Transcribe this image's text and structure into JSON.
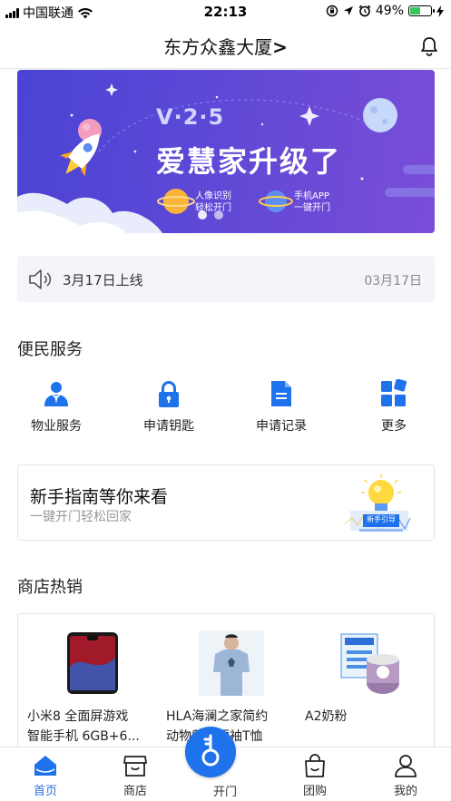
{
  "status_bar": {
    "carrier": "中国联通",
    "time": "22:13",
    "battery_percent": "49%",
    "battery_level": 0.49
  },
  "header": {
    "title": "东方众鑫大厦",
    "title_arrow": ">"
  },
  "banner": {
    "version": "V·2·5",
    "headline": "爱慧家升级了",
    "feature_1_line_1": "人像识别",
    "feature_1_line_2": "轻松开门",
    "feature_2_line_1": "手机APP",
    "feature_2_line_2": "一键开门",
    "page_count": 2,
    "active_page": 1
  },
  "notice": {
    "text": "3月17日上线",
    "date": "03月17日"
  },
  "services_section": {
    "title": "便民服务",
    "items": [
      {
        "label": "物业服务",
        "icon": "property-service-icon"
      },
      {
        "label": "申请钥匙",
        "icon": "lock-icon"
      },
      {
        "label": "申请记录",
        "icon": "document-icon"
      },
      {
        "label": "更多",
        "icon": "grid-more-icon"
      }
    ]
  },
  "guide": {
    "title": "新手指南等你来看",
    "subtitle": "一键开门轻松回家",
    "badge": "新手引导"
  },
  "shop_section": {
    "title": "商店热销",
    "products": [
      {
        "name_line_1": "小米8 全面屏游戏",
        "name_line_2": "智能手机 6GB+6..."
      },
      {
        "name_line_1": "HLA海澜之家简约",
        "name_line_2": "动物印花短袖T恤"
      },
      {
        "name_line_1": "A2奶粉",
        "name_line_2": ""
      }
    ]
  },
  "tabbar": {
    "tabs": [
      {
        "label": "首页",
        "icon": "home-icon",
        "active": true
      },
      {
        "label": "商店",
        "icon": "store-icon",
        "active": false
      },
      {
        "label": "开门",
        "icon": "key-icon",
        "active": false
      },
      {
        "label": "团购",
        "icon": "shopping-bag-icon",
        "active": false
      },
      {
        "label": "我的",
        "icon": "profile-icon",
        "active": false
      }
    ]
  },
  "colors": {
    "accent": "#1e72ec",
    "banner_start": "#4a43d3",
    "banner_end": "#7a4dd7",
    "battery_fill": "#35c759"
  }
}
